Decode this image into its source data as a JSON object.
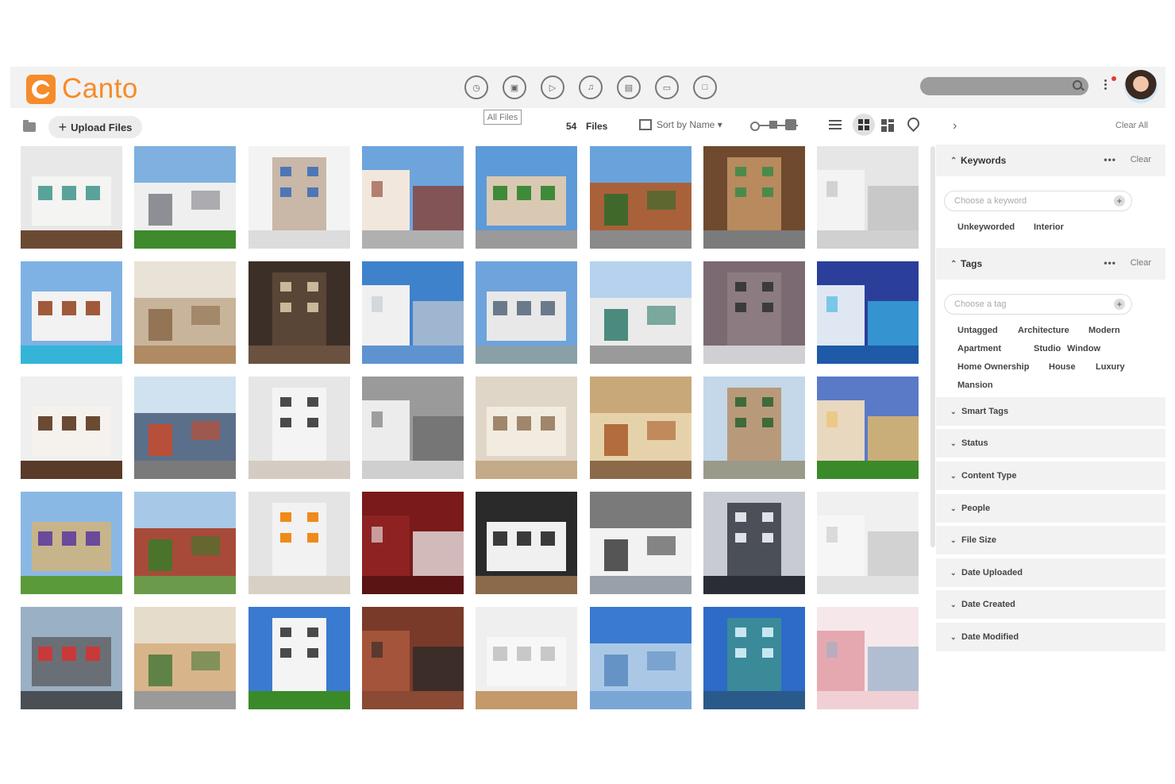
{
  "brand": {
    "name": "Canto",
    "color": "#f68b29"
  },
  "header": {
    "type_icons": [
      "clock-icon",
      "image-icon",
      "video-icon",
      "music-icon",
      "document-icon",
      "presentation-icon",
      "file-icon"
    ],
    "search_placeholder": ""
  },
  "toolbar": {
    "upload_label": "Upload Files",
    "scope_label": "All Files",
    "file_count": "54",
    "files_label": "Files",
    "sort_label": "Sort by Name ▾",
    "clear_all": "Clear All"
  },
  "filters": {
    "keywords": {
      "title": "Keywords",
      "dots": "•••",
      "clear": "Clear",
      "input_placeholder": "Choose a keyword",
      "chips": [
        "Unkeyworded",
        "Interior"
      ]
    },
    "tags": {
      "title": "Tags",
      "dots": "•••",
      "clear": "Clear",
      "input_placeholder": "Choose a tag",
      "chips": [
        "Untagged",
        "Architecture",
        "Modern",
        "Apartment",
        "Studio",
        "Window",
        "Home Ownership",
        "House",
        "Luxury",
        "Mansion"
      ]
    },
    "collapsed": [
      "Smart Tags",
      "Status",
      "Content Type",
      "People",
      "File Size",
      "Date Uploaded",
      "Date Created",
      "Date Modified"
    ]
  },
  "thumbnails": [
    {
      "name": "kitchen-teal-island",
      "sky": "#e8e8e8",
      "main": "#f4f4f2",
      "accent": "#5aa39a",
      "ground": "#6b4a33"
    },
    {
      "name": "suburban-house",
      "sky": "#7fb0e0",
      "main": "#efefef",
      "accent": "#7d7d85",
      "ground": "#3f8a2c"
    },
    {
      "name": "handshake-couple",
      "sky": "#f3f3f3",
      "main": "#c9b7a8",
      "accent": "#4e76b5",
      "ground": "#dcdcdc"
    },
    {
      "name": "spanish-facade",
      "sky": "#6ea4dc",
      "main": "#f1e7dc",
      "accent": "#8a3a2a",
      "ground": "#b0b0b0"
    },
    {
      "name": "street-palms",
      "sky": "#5d9ad8",
      "main": "#d9c9b3",
      "accent": "#3f8a3a",
      "ground": "#9a9a9a"
    },
    {
      "name": "palm-building",
      "sky": "#6aa2dc",
      "main": "#a9613a",
      "accent": "#2f6a2a",
      "ground": "#8a8a8a"
    },
    {
      "name": "wood-patio",
      "sky": "#6f4a2e",
      "main": "#b88a5e",
      "accent": "#4c8a4a",
      "ground": "#7b7b7b"
    },
    {
      "name": "white-loft",
      "sky": "#e6e6e6",
      "main": "#f3f3f3",
      "accent": "#bdbdbd",
      "ground": "#d0d0d0"
    },
    {
      "name": "pool-house",
      "sky": "#7eb2e4",
      "main": "#f2f2f2",
      "accent": "#a05a3a",
      "ground": "#34b5d8"
    },
    {
      "name": "living-room-warm",
      "sky": "#e9e2d6",
      "main": "#c8b49a",
      "accent": "#8a6a4a",
      "ground": "#b08a62"
    },
    {
      "name": "dark-kitchen",
      "sky": "#3b2f28",
      "main": "#5a4637",
      "accent": "#c9b89a",
      "ground": "#6a5140"
    },
    {
      "name": "white-tower",
      "sky": "#3f82cc",
      "main": "#f0f0f0",
      "accent": "#bfc7d2",
      "ground": "#5f93cf"
    },
    {
      "name": "rooftop-modern",
      "sky": "#6ea3dc",
      "main": "#e8e8e8",
      "accent": "#6a7a8a",
      "ground": "#8aa0a8"
    },
    {
      "name": "apartment-block",
      "sky": "#b6d2ee",
      "main": "#eaeaea",
      "accent": "#2f7a6a",
      "ground": "#9a9a9a"
    },
    {
      "name": "grey-lounge",
      "sky": "#7b6a72",
      "main": "#8c7b80",
      "accent": "#3b3b3b",
      "ground": "#cfcfd4"
    },
    {
      "name": "night-villa",
      "sky": "#2b3f9a",
      "main": "#dfe7f2",
      "accent": "#3ab0e0",
      "ground": "#1e5aa8"
    },
    {
      "name": "marble-kitchen",
      "sky": "#efefef",
      "main": "#f5f2ee",
      "accent": "#6a4a33",
      "ground": "#5a3a28"
    },
    {
      "name": "autumn-house",
      "sky": "#d0e2f0",
      "main": "#5b6f8a",
      "accent": "#c94a2a",
      "ground": "#7a7a7a"
    },
    {
      "name": "bright-lounge",
      "sky": "#e6e6e6",
      "main": "#f4f4f4",
      "accent": "#4a4a4a",
      "ground": "#d4ccc2"
    },
    {
      "name": "bathroom-tub",
      "sky": "#9a9a9a",
      "main": "#ececec",
      "accent": "#6a6a6a",
      "ground": "#cfcfcf"
    },
    {
      "name": "dining-chandelier",
      "sky": "#e0d6c8",
      "main": "#f2ebe0",
      "accent": "#a0866a",
      "ground": "#c4aa88"
    },
    {
      "name": "atrium-living",
      "sky": "#c8a878",
      "main": "#e6d2aa",
      "accent": "#a85a2a",
      "ground": "#8a6a4a"
    },
    {
      "name": "stone-villa",
      "sky": "#c4d8ea",
      "main": "#b89a7a",
      "accent": "#3f6a3a",
      "ground": "#9a9a8a"
    },
    {
      "name": "dusk-house",
      "sky": "#5a7ac8",
      "main": "#e8d8c0",
      "accent": "#f0c060",
      "ground": "#3a8a2a"
    },
    {
      "name": "stone-cottage",
      "sky": "#8ab8e4",
      "main": "#c8b48a",
      "accent": "#6a4a9a",
      "ground": "#5a9a3a"
    },
    {
      "name": "brick-house",
      "sky": "#a8c8e8",
      "main": "#a84a3a",
      "accent": "#3a7a2a",
      "ground": "#6a9a4a"
    },
    {
      "name": "orange-sofa",
      "sky": "#e4e4e4",
      "main": "#f2f2f2",
      "accent": "#f08a1a",
      "ground": "#d8d0c4"
    },
    {
      "name": "red-bathroom",
      "sky": "#7a1a1a",
      "main": "#8e2222",
      "accent": "#f0f0f0",
      "ground": "#5a1414"
    },
    {
      "name": "glass-interior",
      "sky": "#2a2a2a",
      "main": "#f0f0f0",
      "accent": "#3a3a3a",
      "ground": "#8a6a4a"
    },
    {
      "name": "round-window-bedroom",
      "sky": "#7a7a7a",
      "main": "#f2f2f2",
      "accent": "#3a3a3a",
      "ground": "#9aa0a8"
    },
    {
      "name": "modern-kitchen-dark",
      "sky": "#c8ccd2",
      "main": "#4a4f58",
      "accent": "#dfe2e6",
      "ground": "#2a2e34"
    },
    {
      "name": "white-kitchen",
      "sky": "#f0f0f0",
      "main": "#f6f6f6",
      "accent": "#c8c8c8",
      "ground": "#e2e2e2"
    },
    {
      "name": "balcony-tower",
      "sky": "#9ab0c4",
      "main": "#6a6f76",
      "accent": "#c83a3a",
      "ground": "#4a4f56"
    },
    {
      "name": "corridor-view",
      "sky": "#e6dccb",
      "main": "#d8b48a",
      "accent": "#4a7a3a",
      "ground": "#9a9a9a"
    },
    {
      "name": "white-blocks",
      "sky": "#3a7ad0",
      "main": "#f4f4f4",
      "accent": "#4a4a4a",
      "ground": "#3a8a2a"
    },
    {
      "name": "fire-escape",
      "sky": "#7a3a2a",
      "main": "#a4543a",
      "accent": "#2a2a2a",
      "ground": "#8a4a34"
    },
    {
      "name": "empty-room",
      "sky": "#efefef",
      "main": "#f7f7f7",
      "accent": "#c8c8c8",
      "ground": "#c49a6a"
    },
    {
      "name": "blue-skyscraper",
      "sky": "#3a7ad0",
      "main": "#aac8e6",
      "accent": "#5a8ac0",
      "ground": "#7aa6d6"
    },
    {
      "name": "glass-tower",
      "sky": "#2e6ac8",
      "main": "#3a8a9a",
      "accent": "#c8e6f0",
      "ground": "#2a5a8a"
    },
    {
      "name": "pink-tower",
      "sky": "#f6e8ea",
      "main": "#e6a8b0",
      "accent": "#9ab0c8",
      "ground": "#f0d0d4"
    }
  ]
}
